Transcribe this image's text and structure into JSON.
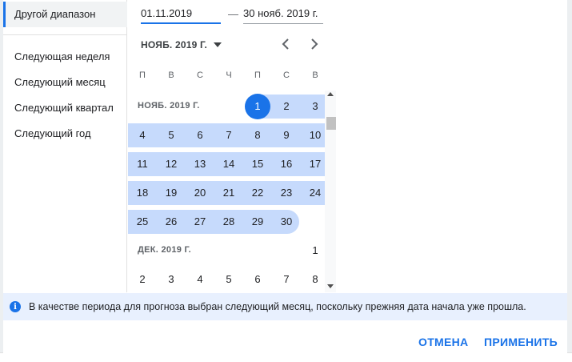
{
  "presets": [
    {
      "label": "Другой диапазон",
      "selected": true
    },
    {
      "label": "Следующая неделя"
    },
    {
      "label": "Следующий месяц"
    },
    {
      "label": "Следующий квартал"
    },
    {
      "label": "Следующий год"
    }
  ],
  "range": {
    "start_value": "01.11.2019",
    "separator": "—",
    "end_value": "30 нояб. 2019 г."
  },
  "header": {
    "month_title": "НОЯБ. 2019 Г."
  },
  "weekdays": [
    "П",
    "В",
    "С",
    "Ч",
    "П",
    "С",
    "В"
  ],
  "months": [
    {
      "label": "НОЯБ. 2019 Г.",
      "weeks": [
        [
          null,
          null,
          null,
          null,
          "1",
          "2",
          "3"
        ],
        [
          "4",
          "5",
          "6",
          "7",
          "8",
          "9",
          "10"
        ],
        [
          "11",
          "12",
          "13",
          "14",
          "15",
          "16",
          "17"
        ],
        [
          "18",
          "19",
          "20",
          "21",
          "22",
          "23",
          "24"
        ],
        [
          "25",
          "26",
          "27",
          "28",
          "29",
          "30",
          null
        ]
      ]
    },
    {
      "label": "ДЕК. 2019 Г.",
      "weeks": [
        [
          null,
          null,
          null,
          null,
          null,
          null,
          "1"
        ],
        [
          "2",
          "3",
          "4",
          "5",
          "6",
          "7",
          "8"
        ]
      ]
    }
  ],
  "selection": {
    "month_index": 0,
    "start_day": "1",
    "end_day": "30"
  },
  "info": {
    "icon": "info-icon",
    "text": "В качестве периода для прогноза выбран следующий месяц, поскольку прежняя дата начала уже прошла."
  },
  "actions": {
    "cancel_label": "ОТМЕНА",
    "apply_label": "ПРИМЕНИТЬ"
  },
  "colors": {
    "accent": "#1a73e8",
    "range_fill": "#c6dafc",
    "info_bg": "#e8f0fe"
  }
}
